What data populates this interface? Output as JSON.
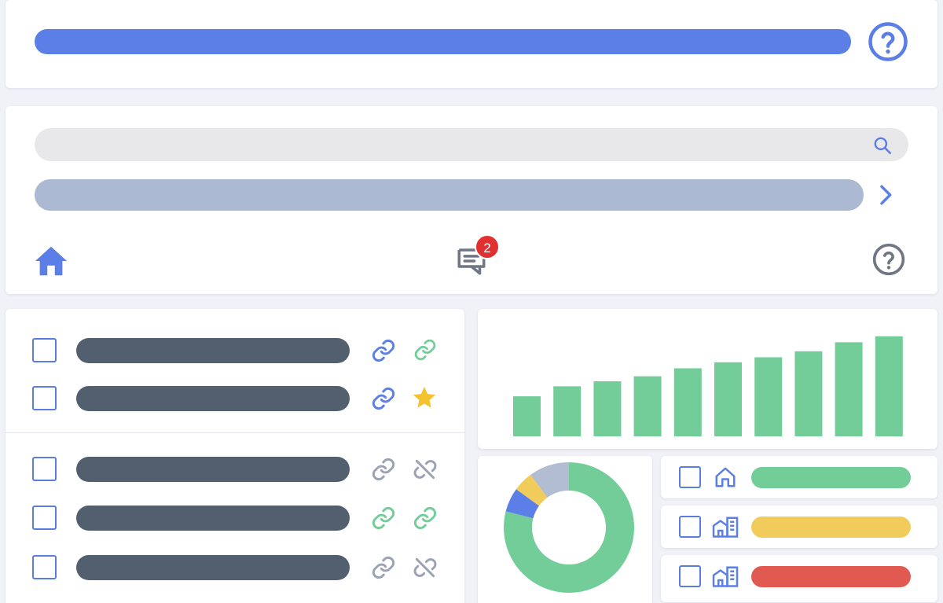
{
  "colors": {
    "accent": "#5b7fe6",
    "dark_bar": "#525f6e",
    "green": "#72cd98",
    "yellow": "#f2cc5a",
    "red": "#e05a52",
    "muted_gray": "#9aa2b4",
    "search_bg": "#e8e8ea",
    "nav_bar": "#acb9d2",
    "badge": "#e03030"
  },
  "top_bar": {
    "help_icon": "question-circle-icon"
  },
  "search": {
    "icon": "search-icon"
  },
  "nav_bar": {
    "icon": "chevron-right-icon"
  },
  "toolbar": {
    "home_icon": "home-icon",
    "chat_icon": "chat-icon",
    "chat_badge_count": "2",
    "help_icon": "question-circle-icon"
  },
  "list_group_a": [
    {
      "checked": false,
      "icon1": "link-icon",
      "icon2": "link-icon-green"
    },
    {
      "checked": false,
      "icon1": "link-icon",
      "icon2": "star-icon"
    }
  ],
  "list_group_b": [
    {
      "checked": false,
      "icon1": "link-icon-gray",
      "icon2": "unlink-icon"
    },
    {
      "checked": false,
      "icon1": "link-icon-green",
      "icon2": "link-icon-green"
    },
    {
      "checked": false,
      "icon1": "link-icon-gray",
      "icon2": "unlink-icon"
    }
  ],
  "chart_data": [
    {
      "type": "bar",
      "categories": [
        "",
        "",
        "",
        "",
        "",
        "",
        "",
        "",
        "",
        ""
      ],
      "values": [
        40,
        50,
        55,
        60,
        68,
        74,
        79,
        85,
        94,
        100
      ],
      "ylim": [
        0,
        110
      ],
      "grid": false
    },
    {
      "type": "pie",
      "donut": true,
      "slices": [
        {
          "value": 79,
          "color": "#72cd98"
        },
        {
          "value": 6,
          "color": "#5b7fe6"
        },
        {
          "value": 5,
          "color": "#f2cc5a"
        },
        {
          "value": 10,
          "color": "#b3bdd2"
        }
      ]
    }
  ],
  "status_list": [
    {
      "checked": false,
      "icon": "home-outline-icon",
      "level": 1,
      "color": "green"
    },
    {
      "checked": false,
      "icon": "buildings-icon",
      "level": 1,
      "color": "yellow"
    },
    {
      "checked": false,
      "icon": "buildings-icon",
      "level": 1,
      "color": "red"
    }
  ]
}
